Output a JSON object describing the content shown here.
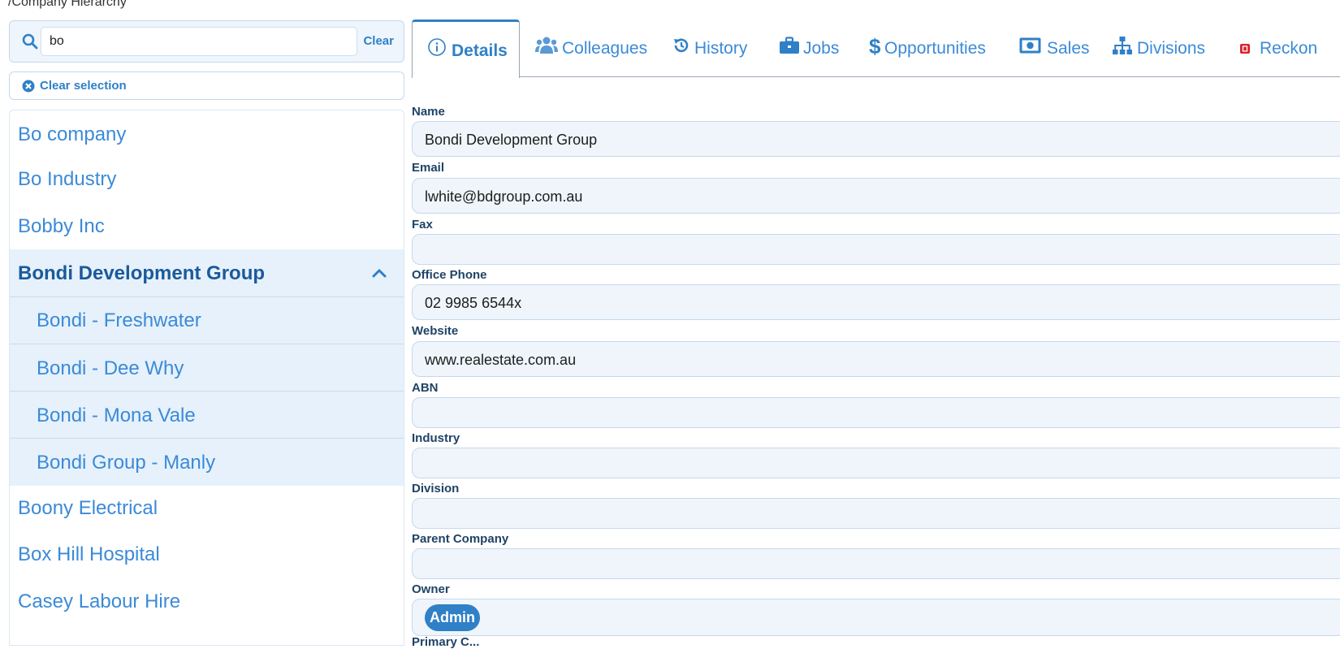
{
  "breadcrumb": "/Company Hierarchy",
  "search": {
    "value": "bo",
    "clear_label": "Clear"
  },
  "clear_selection_label": "Clear selection",
  "tree": {
    "items": [
      {
        "label": "Bo company"
      },
      {
        "label": "Bo Industry"
      },
      {
        "label": "Bobby Inc"
      },
      {
        "label": "Bondi Development Group",
        "selected": true,
        "expanded": true,
        "children": [
          {
            "label": "Bondi - Freshwater"
          },
          {
            "label": "Bondi - Dee Why"
          },
          {
            "label": "Bondi - Mona Vale"
          },
          {
            "label": "Bondi Group - Manly"
          }
        ]
      },
      {
        "label": "Boony Electrical"
      },
      {
        "label": "Box Hill Hospital"
      },
      {
        "label": "Casey Labour Hire"
      }
    ]
  },
  "tabs": [
    {
      "label": "Details",
      "icon": "info-icon",
      "active": true
    },
    {
      "label": "Colleagues",
      "icon": "users-icon"
    },
    {
      "label": "History",
      "icon": "history-icon"
    },
    {
      "label": "Jobs",
      "icon": "briefcase-icon"
    },
    {
      "label": "Opportunities",
      "icon": "dollar-icon"
    },
    {
      "label": "Sales",
      "icon": "money-icon"
    },
    {
      "label": "Divisions",
      "icon": "sitemap-icon"
    },
    {
      "label": "Reckon",
      "icon": "reckon-logo-icon"
    }
  ],
  "form": {
    "name": {
      "label": "Name",
      "value": "Bondi Development Group"
    },
    "email": {
      "label": "Email",
      "value": "lwhite@bdgroup.com.au"
    },
    "fax": {
      "label": "Fax",
      "value": ""
    },
    "office_phone": {
      "label": "Office Phone",
      "value": "02 9985 6544x"
    },
    "website": {
      "label": "Website",
      "value": "www.realestate.com.au"
    },
    "abn": {
      "label": "ABN",
      "value": ""
    },
    "industry": {
      "label": "Industry",
      "value": ""
    },
    "division": {
      "label": "Division",
      "value": ""
    },
    "parent_company": {
      "label": "Parent Company",
      "value": ""
    },
    "owner": {
      "label": "Owner",
      "value": "Admin"
    },
    "next_label_partial": "Primary C..."
  },
  "colors": {
    "accent": "#2f80c7",
    "link": "#3b8ad8",
    "selected_bg": "#e6f1fb",
    "input_bg": "#eff5fb",
    "reckon_red": "#d9232e"
  }
}
